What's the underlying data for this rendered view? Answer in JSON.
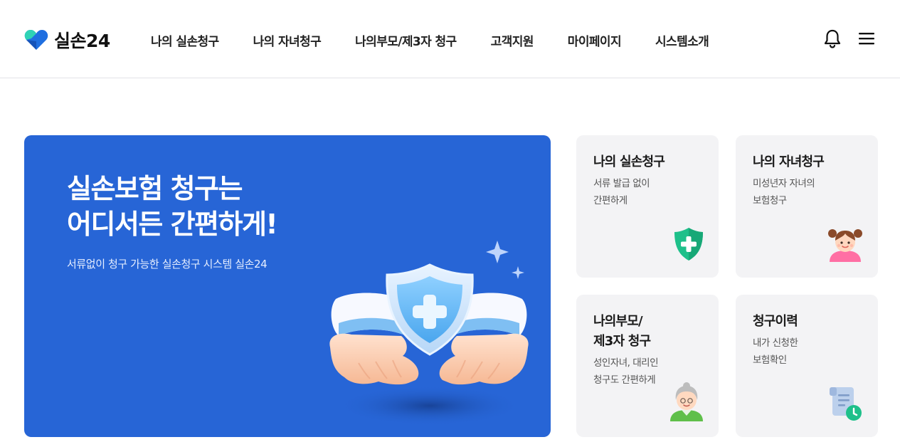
{
  "header": {
    "logo_text": "실손24",
    "nav": [
      {
        "label": "나의 실손청구"
      },
      {
        "label": "나의 자녀청구"
      },
      {
        "label": "나의부모/제3자 청구"
      },
      {
        "label": "고객지원"
      },
      {
        "label": "마이페이지"
      },
      {
        "label": "시스템소개"
      }
    ]
  },
  "hero": {
    "title": "실손보험 청구는\n어디서든 간편하게!",
    "subtitle": "서류없이 청구 가능한 실손청구 시스템 실손24"
  },
  "cards": [
    {
      "title": "나의 실손청구",
      "desc": "서류 발급 없이\n간편하게",
      "icon": "shield-plus-icon"
    },
    {
      "title": "나의 자녀청구",
      "desc": "미성년자 자녀의\n보험청구",
      "icon": "child-icon"
    },
    {
      "title": "나의부모/\n제3자 청구",
      "desc": "성인자녀, 대리인\n청구도 간편하게",
      "icon": "grandparent-icon"
    },
    {
      "title": "청구이력",
      "desc": "내가 신청한\n보험확인",
      "icon": "history-document-icon"
    }
  ],
  "colors": {
    "brand_blue": "#2765d6",
    "accent_green": "#1ec08a",
    "card_bg": "#f3f3f5"
  }
}
